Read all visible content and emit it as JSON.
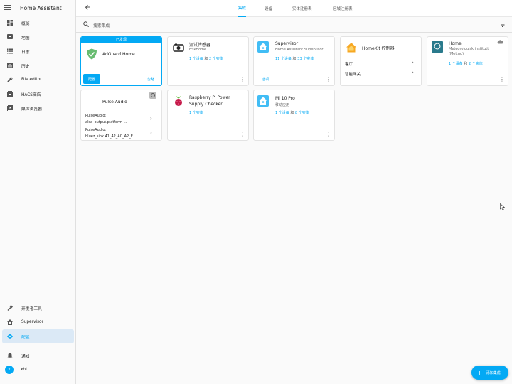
{
  "app": {
    "title": "Home Assistant"
  },
  "sidebar": {
    "items": [
      {
        "label": "概览",
        "icon": "dashboard-icon"
      },
      {
        "label": "地图",
        "icon": "map-icon"
      },
      {
        "label": "日志",
        "icon": "logbook-icon"
      },
      {
        "label": "历史",
        "icon": "history-icon"
      },
      {
        "label": "File editor",
        "icon": "wrench-icon"
      },
      {
        "label": "HACS商店",
        "icon": "hacs-icon"
      },
      {
        "label": "媒体浏览器",
        "icon": "media-icon"
      }
    ],
    "bottom": [
      {
        "label": "开发者工具",
        "icon": "hammer-icon"
      },
      {
        "label": "Supervisor",
        "icon": "supervisor-icon"
      },
      {
        "label": "配置",
        "icon": "gear-icon"
      }
    ],
    "notifications": "通知",
    "user": {
      "initial": "x",
      "name": "xht"
    }
  },
  "tabs": [
    {
      "label": "集成",
      "active": true
    },
    {
      "label": "设备",
      "active": false
    },
    {
      "label": "实体注册表",
      "active": false
    },
    {
      "label": "区域注册表",
      "active": false
    }
  ],
  "search": {
    "placeholder": "搜索集成"
  },
  "cards": {
    "adguard": {
      "banner": "已发现",
      "title": "AdGuard Home",
      "configure": "配置",
      "ignore": "忽略"
    },
    "esphome": {
      "title": "测试传感器",
      "sub": "ESPHome",
      "link_a": "1 个设备",
      "and": "和",
      "link_b": "2 个实体"
    },
    "supervisor": {
      "title": "Supervisor",
      "sub": "Home Assistant Supervisor",
      "link_a": "11 个设备",
      "and": "和",
      "link_b": "33 个实体",
      "options": "选项"
    },
    "homekit": {
      "title": "HomeKit 控制器",
      "row1": "客厅",
      "row2": "智能网关"
    },
    "met": {
      "title": "Home",
      "sub1": "Meteorologisk institutt",
      "sub2": "(Met.no)",
      "link_a": "1 个设备",
      "and": "和",
      "link_b": "2 个实体"
    },
    "pulse": {
      "title": "Pulse Audio",
      "row1a": "PulseAudio:",
      "row1b": "alsa_output.platform ...",
      "row2a": "PulseAudio:",
      "row2b": "bluez_sink.41_42_AC_A2_E..."
    },
    "rpi": {
      "title1": "Raspberry Pi Power",
      "title2": "Supply Checker",
      "link_a": "1 个实体"
    },
    "mi": {
      "title": "Mi 10 Pro",
      "sub": "移动应用",
      "link_a": "1 个设备",
      "and": "和",
      "link_b": "8 个实体"
    }
  },
  "fab": {
    "label": "添加集成"
  },
  "colors": {
    "accent": "#03a9f4",
    "rpi_red": "#c51a4a",
    "ha_blue": "#41bdf5",
    "met_teal": "#2a7a8c"
  }
}
